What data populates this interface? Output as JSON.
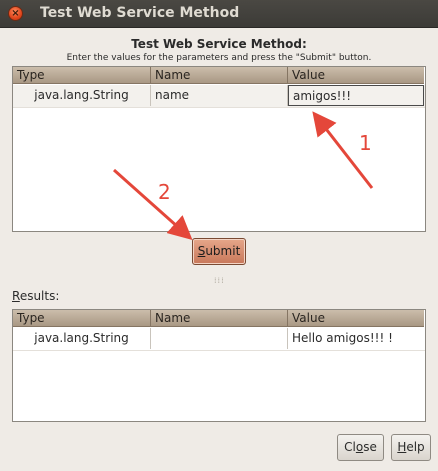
{
  "window": {
    "title": "Test Web Service Method"
  },
  "dialog": {
    "heading": "Test Web Service Method:",
    "instruction": "Enter the values for the parameters and press the \"Submit\" button."
  },
  "params_table": {
    "columns": [
      "Type",
      "Name",
      "Value"
    ],
    "rows": [
      {
        "type": "java.lang.String",
        "name": "name",
        "value": "amigos!!!"
      }
    ]
  },
  "submit_button": {
    "label_pre": "",
    "mnemonic": "S",
    "label_post": "ubmit"
  },
  "results": {
    "label_mnemonic": "R",
    "label_rest": "esults:",
    "columns": [
      "Type",
      "Name",
      "Value"
    ],
    "rows": [
      {
        "type": "java.lang.String",
        "name": "",
        "value": "Hello amigos!!! !"
      }
    ]
  },
  "close_button": {
    "label_pre": "Cl",
    "mnemonic": "o",
    "label_post": "se"
  },
  "help_button": {
    "label_pre": "",
    "mnemonic": "H",
    "label_post": "elp"
  },
  "annotations": {
    "label_1": "1",
    "label_2": "2",
    "color": "#e4473a"
  }
}
